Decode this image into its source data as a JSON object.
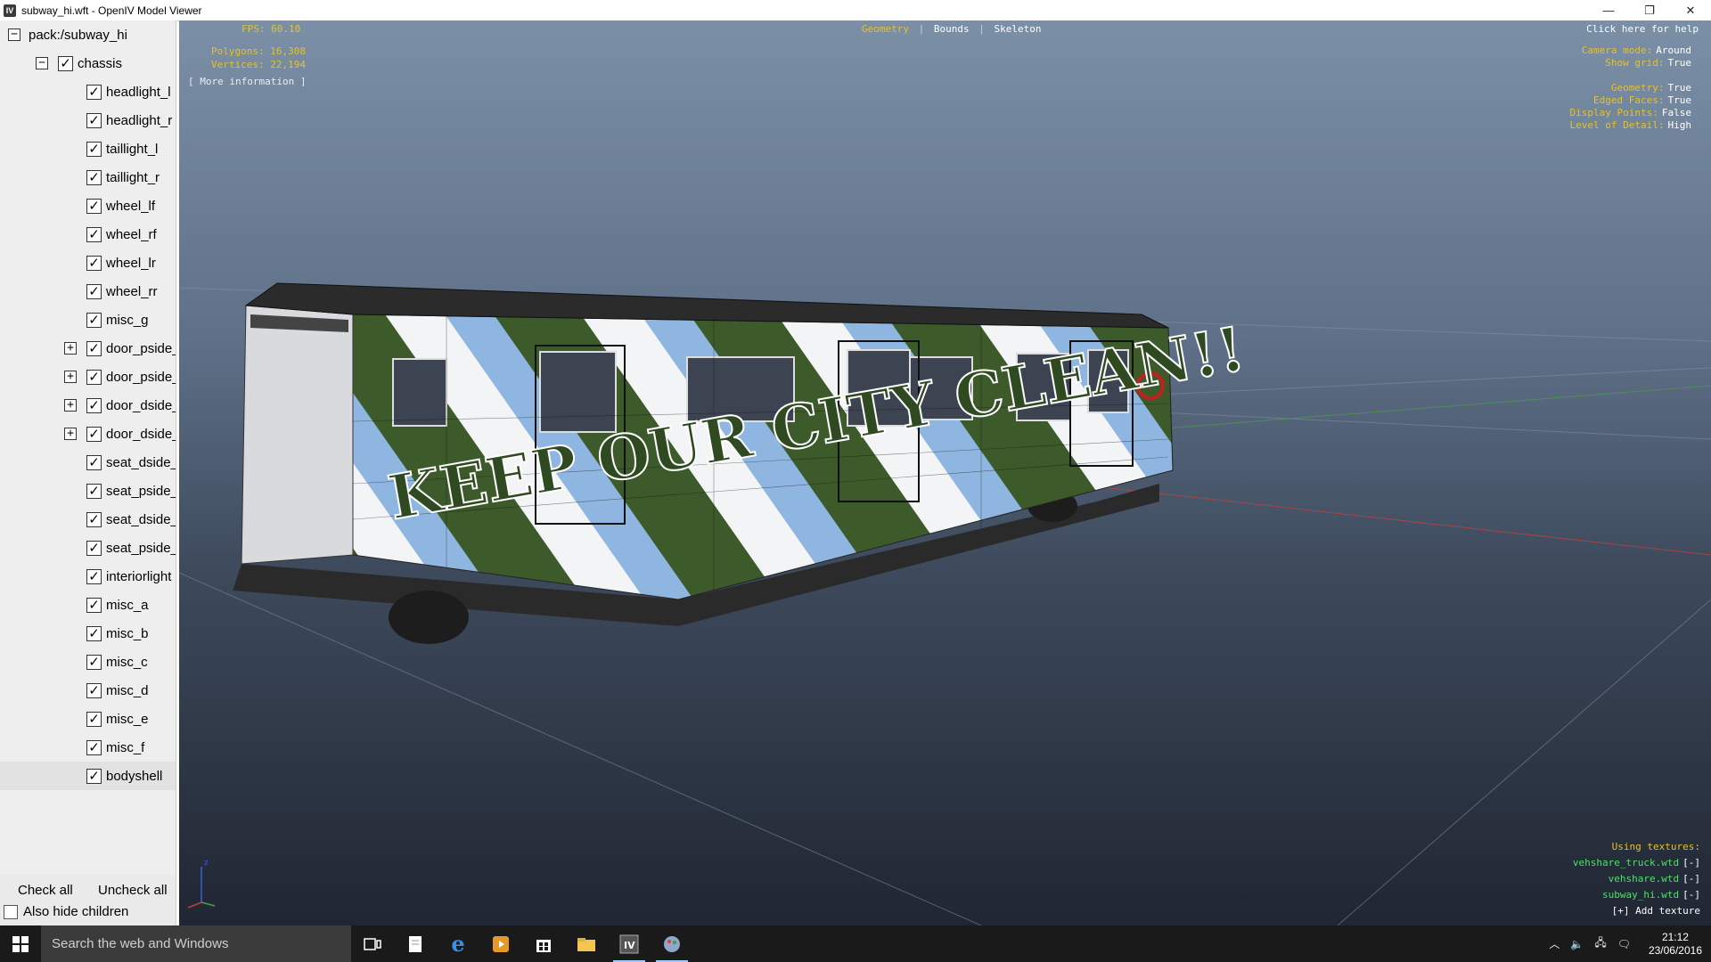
{
  "window": {
    "title": "subway_hi.wft - OpenIV Model Viewer",
    "app_icon_letter": "IV",
    "controls": {
      "minimize": "—",
      "maximize": "❐",
      "close": "✕"
    }
  },
  "tree": {
    "root": "pack:/subway_hi",
    "chassis": "chassis",
    "items": [
      {
        "label": "headlight_l",
        "expandable": false
      },
      {
        "label": "headlight_r",
        "expandable": false
      },
      {
        "label": "taillight_l",
        "expandable": false
      },
      {
        "label": "taillight_r",
        "expandable": false
      },
      {
        "label": "wheel_lf",
        "expandable": false
      },
      {
        "label": "wheel_rf",
        "expandable": false
      },
      {
        "label": "wheel_lr",
        "expandable": false
      },
      {
        "label": "wheel_rr",
        "expandable": false
      },
      {
        "label": "misc_g",
        "expandable": false
      },
      {
        "label": "door_pside_",
        "expandable": true
      },
      {
        "label": "door_pside_",
        "expandable": true
      },
      {
        "label": "door_dside_",
        "expandable": true
      },
      {
        "label": "door_dside_",
        "expandable": true
      },
      {
        "label": "seat_dside_",
        "expandable": false
      },
      {
        "label": "seat_pside_",
        "expandable": false
      },
      {
        "label": "seat_dside_",
        "expandable": false
      },
      {
        "label": "seat_pside_",
        "expandable": false
      },
      {
        "label": "interiorlight",
        "expandable": false
      },
      {
        "label": "misc_a",
        "expandable": false
      },
      {
        "label": "misc_b",
        "expandable": false
      },
      {
        "label": "misc_c",
        "expandable": false
      },
      {
        "label": "misc_d",
        "expandable": false
      },
      {
        "label": "misc_e",
        "expandable": false
      },
      {
        "label": "misc_f",
        "expandable": false
      },
      {
        "label": "bodyshell",
        "expandable": false,
        "selected": true
      }
    ],
    "check_all": "Check all",
    "uncheck_all": "Uncheck all",
    "also_hide_children": "Also hide children"
  },
  "viewport": {
    "fps": "FPS: 60.10",
    "polygons": "Polygons: 16,308",
    "vertices": "Vertices: 22,194",
    "more_info": "[ More information ]",
    "tabs": {
      "geometry": "Geometry",
      "bounds": "Bounds",
      "skeleton": "Skeleton",
      "sep": "|"
    },
    "help": "Click here for help",
    "settings": [
      {
        "key": "Camera mode:",
        "value": "Around"
      },
      {
        "key": "Show grid:",
        "value": "True"
      },
      {
        "key": "Geometry:",
        "value": "True"
      },
      {
        "key": "Edged Faces:",
        "value": "True"
      },
      {
        "key": "Display Points:",
        "value": "False"
      },
      {
        "key": "Level of Detail:",
        "value": "High"
      }
    ],
    "textures_title": "Using textures:",
    "textures": [
      {
        "name": "vehshare_truck.wtd",
        "action": "[-]"
      },
      {
        "name": "vehshare.wtd",
        "action": "[-]"
      },
      {
        "name": "subway_hi.wtd",
        "action": "[-]"
      }
    ],
    "add_texture": "[+] Add texture",
    "train_text": "KEEP OUR CITY CLEAN!!",
    "axis_z": "z"
  },
  "taskbar": {
    "search_placeholder": "Search the web and Windows",
    "time": "21:12",
    "date": "23/06/2016"
  },
  "colors": {
    "accent": "#e2c22d",
    "texture_green": "#4ee06a",
    "train_green": "#3d5a2a",
    "train_blue": "#8fb6e0"
  }
}
